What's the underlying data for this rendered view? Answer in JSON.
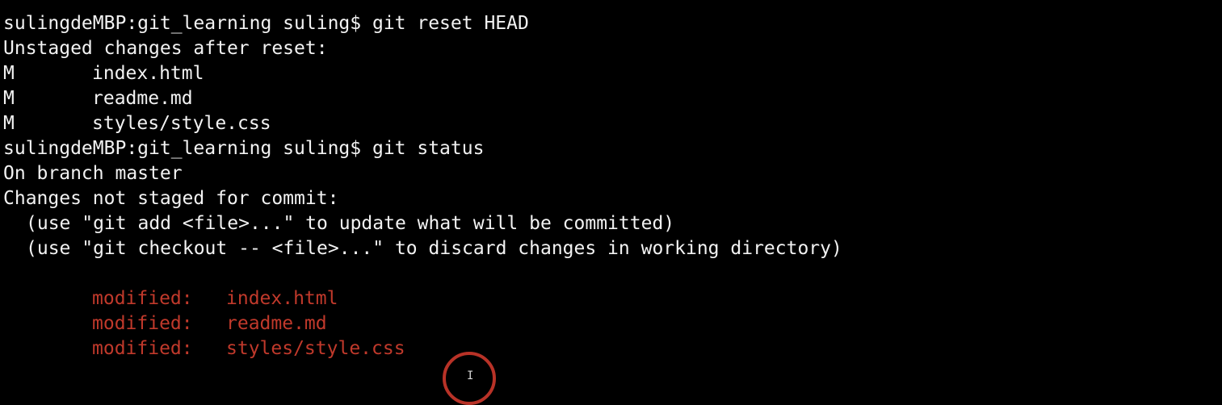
{
  "terminal": {
    "colors": {
      "background": "#000000",
      "foreground": "#f2f2f2",
      "modified": "#c0392b",
      "cursor_ring": "#b83227"
    },
    "cmd1": {
      "prompt": "sulingdeMBP:git_learning suling$ ",
      "command": "git reset HEAD"
    },
    "reset_header": "Unstaged changes after reset:",
    "reset_files": [
      {
        "status": "M",
        "file": "index.html"
      },
      {
        "status": "M",
        "file": "readme.md"
      },
      {
        "status": "M",
        "file": "styles/style.css"
      }
    ],
    "cmd2": {
      "prompt": "sulingdeMBP:git_learning suling$ ",
      "command": "git status"
    },
    "branch_line": "On branch master",
    "changes_header": "Changes not staged for commit:",
    "hints": [
      "(use \"git add <file>...\" to update what will be committed)",
      "(use \"git checkout -- <file>...\" to discard changes in working directory)"
    ],
    "modified_files": [
      {
        "label": "modified:",
        "file": "index.html"
      },
      {
        "label": "modified:",
        "file": "readme.md"
      },
      {
        "label": "modified:",
        "file": "styles/style.css"
      }
    ],
    "cursor_icon": "ibeam-cursor-icon",
    "cursor_glyph": "I"
  }
}
